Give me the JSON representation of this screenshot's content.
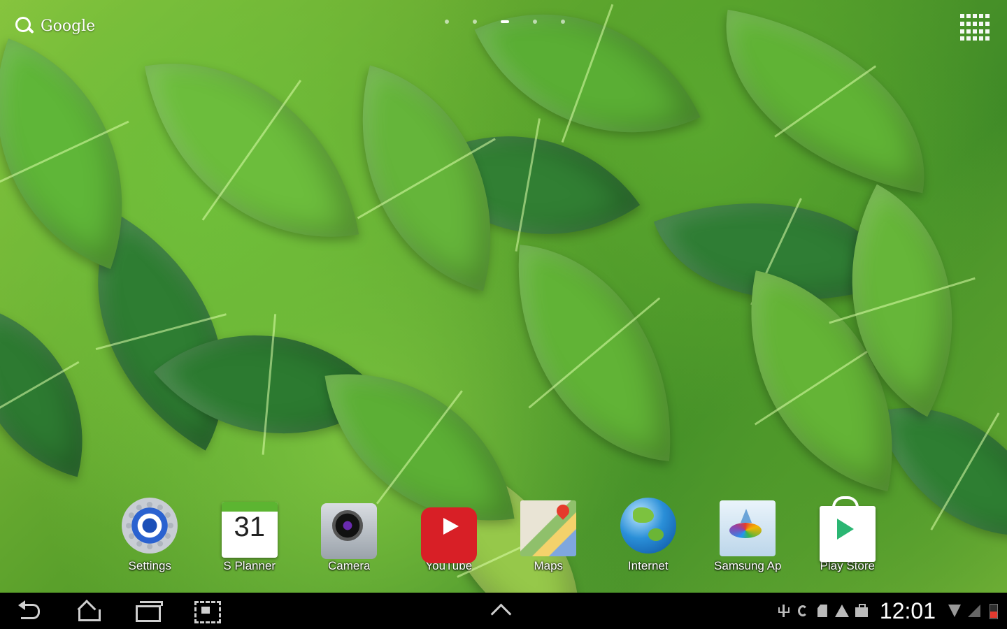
{
  "search": {
    "label": "Google"
  },
  "pager": {
    "pages": 5,
    "active_index": 2
  },
  "dock": {
    "apps": [
      {
        "label": "Settings",
        "icon": "settings-icon"
      },
      {
        "label": "S Planner",
        "icon": "calendar-icon",
        "date": "31"
      },
      {
        "label": "Camera",
        "icon": "camera-icon"
      },
      {
        "label": "YouTube",
        "icon": "youtube-icon"
      },
      {
        "label": "Maps",
        "icon": "maps-icon"
      },
      {
        "label": "Internet",
        "icon": "globe-icon"
      },
      {
        "label": "Samsung Ap",
        "icon": "samsung-apps-icon"
      },
      {
        "label": "Play Store",
        "icon": "play-store-icon"
      }
    ]
  },
  "navbar": {
    "buttons": [
      "back-icon",
      "home-icon",
      "recent-apps-icon",
      "screenshot-icon",
      "up-arrow-icon"
    ]
  },
  "status": {
    "time": "12:01",
    "icons": [
      "usb-icon",
      "sync-icon",
      "sd-card-icon",
      "warning-icon",
      "shopping-bag-icon",
      "wifi-icon",
      "signal-icon",
      "battery-icon"
    ],
    "battery_color": "#e23a2f"
  }
}
